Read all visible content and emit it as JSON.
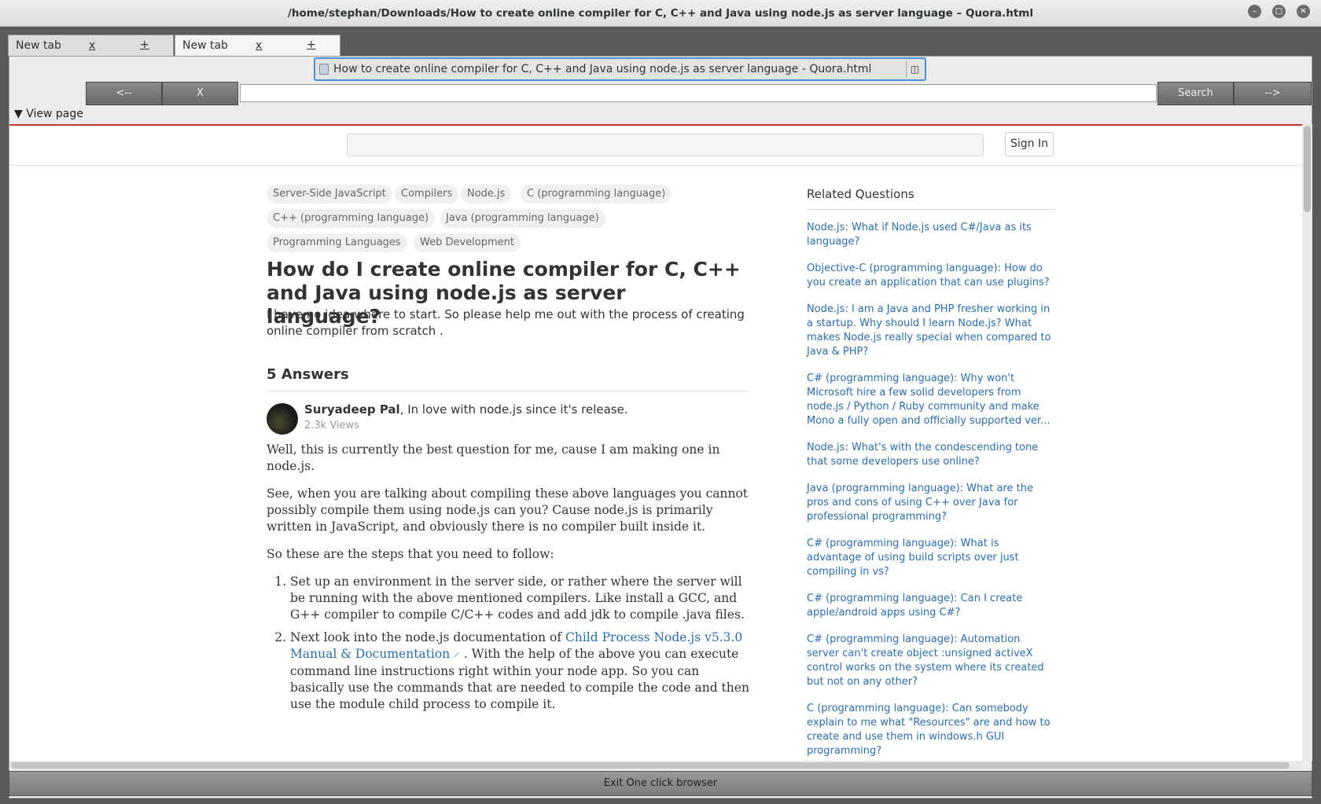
{
  "window": {
    "title": "/home/stephan/Downloads/How to create online compiler for C, C++ and Java using node.js as server language – Quora.html"
  },
  "tabs": [
    {
      "label": "New tab",
      "close": "x",
      "add": "+"
    },
    {
      "label": "New tab",
      "close": "x",
      "add": "+"
    }
  ],
  "url_bar": {
    "text": "How to create online compiler for C, C++ and Java using node.js as server language - Quora.html"
  },
  "nav": {
    "back": "<--",
    "stop": "X",
    "search": "Search",
    "forward": "-->"
  },
  "view_page": "View page",
  "site": {
    "sign_in": "Sign In"
  },
  "topics": [
    "Server-Side JavaScript",
    "Compilers",
    "Node.js",
    "C (programming language)",
    "C++ (programming language)",
    "Java (programming language)",
    "Programming Languages",
    "Web Development"
  ],
  "question": {
    "title": "How do I create online compiler for C, C++ and Java using node.js as server language?",
    "detail": "I have no idea where to start. So please help me out with the process of creating online compiler from scratch ."
  },
  "answers_count": "5 Answers",
  "answer": {
    "author": "Suryadeep Pal",
    "credential": ", In love with node.js since it's release.",
    "views": "2.3k Views",
    "p1": "Well, this is currently the best question for me, cause I am making one in node.js.",
    "p2": "See, when you are talking about compiling these above languages you cannot possibly compile them using node.js can you? Cause node.js is primarily written in JavaScript, and obviously there is no compiler built inside it.",
    "p3": "So these are the steps that you need to follow:",
    "step1": "Set up an environment in the server side, or rather where the server will be running with the above mentioned compilers. Like install a GCC, and G++ compiler to compile C/C++ codes and add jdk to compile .java files.",
    "step2_pre": "Next look into the node.js documentation of ",
    "step2_link": "Child Process Node.js v5.3.0 Manual & Documentation",
    "step2_post": " . With the help of the above you can execute command line instructions right within your node app. So you can basically use the commands that are needed to compile the code and then use the module child process to compile it."
  },
  "related": {
    "heading": "Related Questions",
    "items": [
      "Node.js: What if Node.js used C#/Java as its language?",
      "Objective-C (programming language): How do you create an application that can use plugins?",
      "Node.js: I am a Java and PHP fresher working in a startup. Why should I learn Node.js? What makes Node.js really special when compared to Java & PHP?",
      "C# (programming language): Why won't Microsoft hire a few solid developers from node.js / Python / Ruby community and make Mono a fully open and officially supported ver...",
      "Node.js: What's with the condescending tone that some developers use online?",
      "Java (programming language): What are the pros and cons of using C++ over Java for professional programming?",
      "C# (programming language): What is advantage of using build scripts over just compiling in vs?",
      "C# (programming language): Can I create apple/android apps using C#?",
      "C# (programming language): Automation server can't create object :unsigned activeX control works on the system where its created but not on any other?",
      "C (programming language): Can somebody explain to me what \"Resources\" are and how to create and use them in windows.h GUI programming?"
    ]
  },
  "exit_button": "Exit One click browser",
  "icons": {
    "minimize": "minimize-icon",
    "maximize": "maximize-icon",
    "close": "close-icon",
    "favicon": "page-icon",
    "clear": "clear-icon",
    "triangle": "disclosure-triangle-icon",
    "external": "external-link-icon"
  }
}
